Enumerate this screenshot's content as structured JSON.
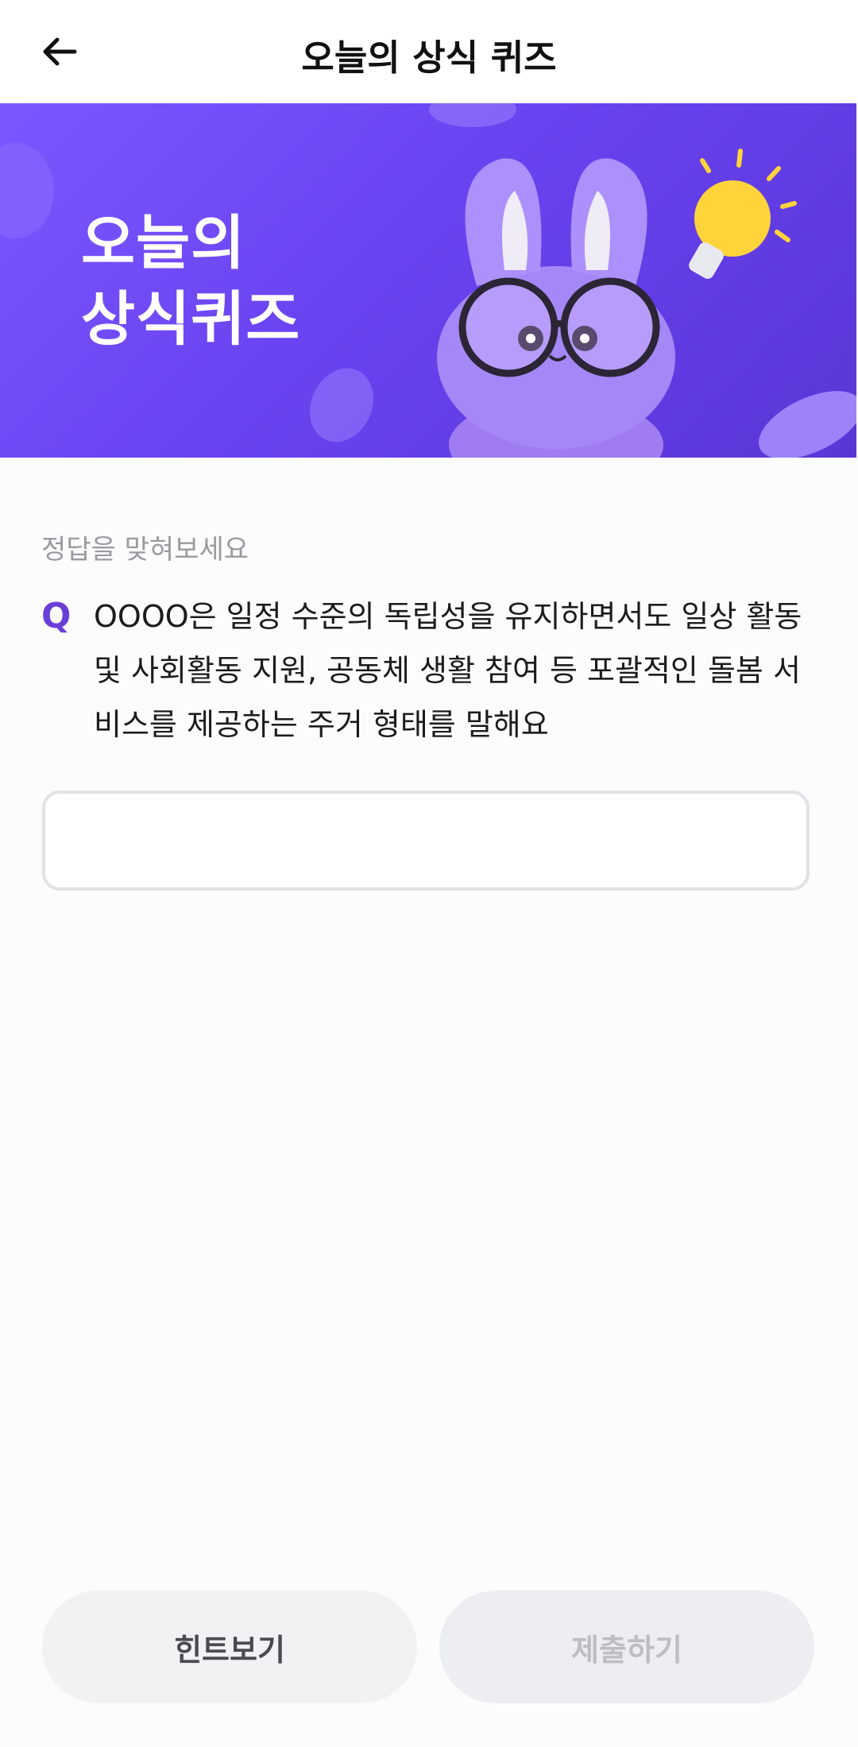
{
  "header": {
    "title": "오늘의 상식 퀴즈"
  },
  "banner": {
    "title_line1": "오늘의",
    "title_line2": "상식퀴즈"
  },
  "quiz": {
    "instruction": "정답을 맞혀보세요",
    "q_mark": "Q",
    "question": "OOOO은 일정 수준의 독립성을 유지하면서도 일상 활동 및 사회활동 지원, 공동체 생활 참여 등 포괄적인 돌봄 서비스를 제공하는 주거 형태를 말해요",
    "answer_value": "",
    "answer_placeholder": ""
  },
  "buttons": {
    "hint_label": "힌트보기",
    "submit_label": "제출하기"
  },
  "colors": {
    "accent": "#6a3fd8",
    "banner": "#7c57ff"
  }
}
